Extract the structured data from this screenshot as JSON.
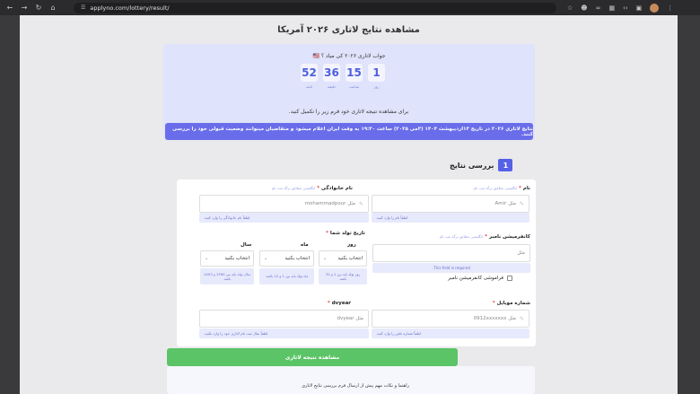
{
  "browser": {
    "url": "applyno.com/lottery/result/"
  },
  "page": {
    "title": "مشاهده نتایج لاتاری ۲۰۲۶ آمریکا",
    "hero_question": "جواب لاتاری ۲۰۲۶ کی میاد ؟ 🇺🇸",
    "countdown": [
      {
        "value": "52",
        "label": "ثانیه"
      },
      {
        "value": "36",
        "label": "دقیقه"
      },
      {
        "value": "15",
        "label": "ساعت"
      },
      {
        "value": "1",
        "label": "روز"
      }
    ],
    "instruction": "برای مشاهده نتیجه لاتاری خود فرم زیر را تکمیل کنید.",
    "notice": "نتایج لاتاری ۲۰۲۶ در تاریخ ۱۳اردیبهشت ۱۴۰۴ (۳می ۲۰۲۵) ساعت ۱۹:۳۰ به وقت ایران اعلام میشود و متقاضیان میتوانند وضعیت قبولی خود را بررسی کنند."
  },
  "section": {
    "number": "1",
    "title": "بررسی نتایج"
  },
  "form": {
    "first_name": {
      "label": "نام",
      "req": "*",
      "sub": "انگلیسی مطابق برگه ثبت نام",
      "placeholder": "Amir مثل",
      "hint": "لطفاً نام را وارد کنید."
    },
    "last_name": {
      "label": "نام خانوادگی",
      "req": "*",
      "sub": "انگلیسی مطابق برگه ثبت نام",
      "placeholder": "mohammadpour مثل",
      "hint": "لطفاً نام خانوادگی را وارد کنید."
    },
    "confirmation": {
      "label": "کانفرمیشن نامبر",
      "req": "*",
      "sub": "انگلیسی مطابق برگه ثبت نام",
      "placeholder": "مثل",
      "error": "This field is required.",
      "forgot_label": "فراموشی کانفرمیشن نامبر"
    },
    "birth": {
      "label": "تاریخ تولد شما",
      "req": "*",
      "day_label": "روز",
      "month_label": "ماه",
      "year_label": "سال",
      "day_value": "انتخاب بکنید",
      "month_value": "انتخاب بکنید",
      "year_value": "انتخاب بکنید",
      "day_hint": "روز تولد باید بین 1 و 31 باشد.",
      "month_hint": "ماه تولد باید بین 1 و 12 باشد.",
      "year_hint": "سال تولد باید بین 1390 و 1403 باشد."
    },
    "mobile": {
      "label": "شماره موبایل",
      "req": "*",
      "placeholder": "0912xxxxxxx مثل",
      "hint": "لطفاً شماره تلفن را وارد کنید."
    },
    "dvyear": {
      "label": "dvyear",
      "req": "*",
      "placeholder": "dvyear مثل",
      "hint": "لطفاً سال ثبت نام لاتاری خود را وارد بکنید."
    }
  },
  "submit_label": "مشاهده نتیجه لاتاری",
  "tips_text": "راهنما و نکات مهم پیش از ارسال فرم بررسی نتایج لاتاری",
  "colors": {
    "accent": "#5561e6",
    "notice_bg": "#6a6dea",
    "submit": "#5bc467",
    "hero_bg": "#dfe3fb"
  }
}
